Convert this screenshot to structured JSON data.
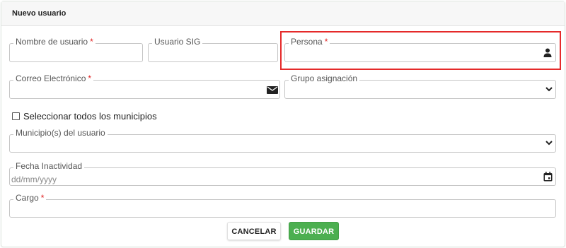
{
  "form": {
    "title": "Nuevo usuario",
    "fields": {
      "nombre_usuario": {
        "label": "Nombre de usuario",
        "required_mark": "*",
        "value": ""
      },
      "usuario_sig": {
        "label": "Usuario SIG",
        "value": ""
      },
      "persona": {
        "label": "Persona",
        "required_mark": "*",
        "value": "",
        "icon": "person-icon"
      },
      "correo": {
        "label": "Correo Electrónico",
        "required_mark": "*",
        "value": "",
        "icon": "envelope-icon"
      },
      "grupo": {
        "label": "Grupo asignación",
        "value": "",
        "icon": "chevron-down-icon"
      },
      "municipios": {
        "label": "Municipio(s) del usuario",
        "value": "",
        "icon": "chevron-down-icon"
      },
      "fecha": {
        "label": "Fecha Inactividad",
        "placeholder": "dd/mm/yyyy",
        "icon": "calendar-icon"
      },
      "cargo": {
        "label": "Cargo",
        "required_mark": "*",
        "value": ""
      }
    },
    "select_all": {
      "label": "Seleccionar todos los municipios",
      "checked": false
    },
    "buttons": {
      "cancel": "CANCELAR",
      "save": "GUARDAR"
    }
  },
  "colors": {
    "accent_save": "#4caf50",
    "required": "#e02020",
    "highlight": "#e52a2a"
  }
}
